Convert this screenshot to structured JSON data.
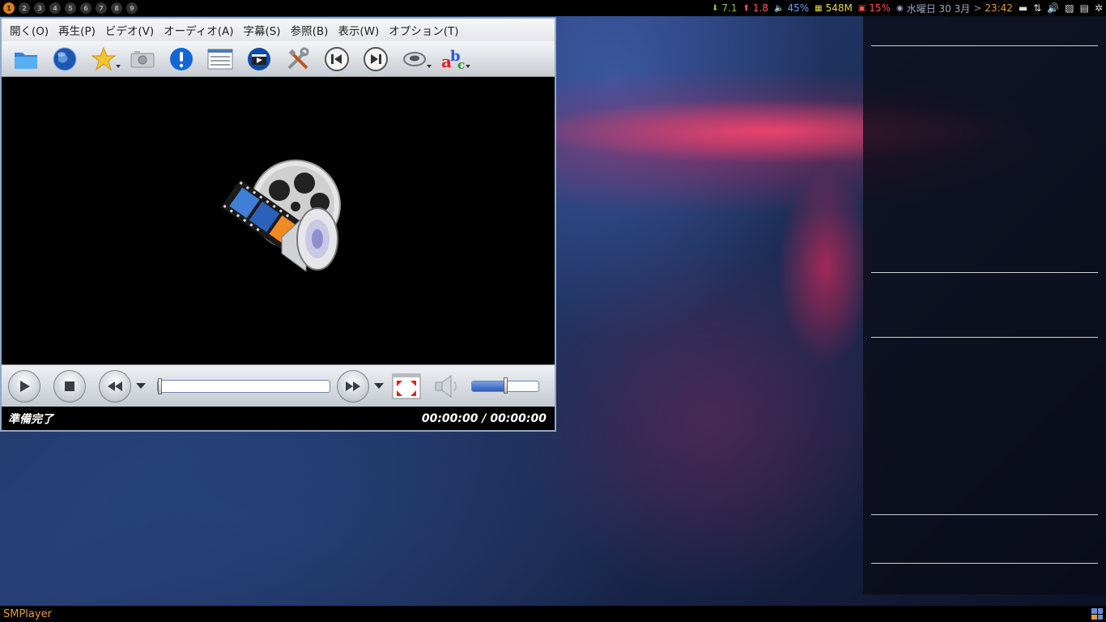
{
  "top_panel": {
    "workspaces": [
      "1",
      "2",
      "3",
      "4",
      "5",
      "6",
      "7",
      "8",
      "9"
    ],
    "active_workspace": "1",
    "net_down": "7.1",
    "net_up": "1.8",
    "volume": "45%",
    "memory": "548M",
    "cpu": "15%",
    "date": "水曜日 30 3月",
    "separator": ">",
    "time": "23:42",
    "colors": {
      "down": "#8bc34a",
      "up": "#ff5a5a",
      "volume": "#6aa0ff",
      "memory": "#e8d44d",
      "cpu": "#ff4d4d",
      "time": "#e89a3a",
      "active_ws": "#d9801a"
    },
    "icons": [
      "arrow-down-icon",
      "arrow-up-icon",
      "speaker-icon",
      "memory-icon",
      "cpu-icon",
      "clock-icon",
      "network-icon",
      "transfer-icon",
      "volume-icon",
      "image-icon",
      "clipboard-icon",
      "settings-icon"
    ]
  },
  "player": {
    "menu": [
      "開く(O)",
      "再生(P)",
      "ビデオ(V)",
      "オーディオ(A)",
      "字幕(S)",
      "参照(B)",
      "表示(W)",
      "オプション(T)"
    ],
    "toolbar_icons": [
      "folder-icon",
      "globe-icon",
      "star-icon",
      "camera-icon",
      "info-icon",
      "playlist-icon",
      "preferences-icon",
      "tools-icon",
      "previous-icon",
      "next-icon",
      "audio-track-icon",
      "subtitle-icon"
    ],
    "status": "準備完了",
    "time": "00:00:00 / 00:00:00",
    "seek_position": 0,
    "volume_level": 0.5,
    "accent": "#2e5db8"
  },
  "taskbar": {
    "title": "SMPlayer"
  }
}
